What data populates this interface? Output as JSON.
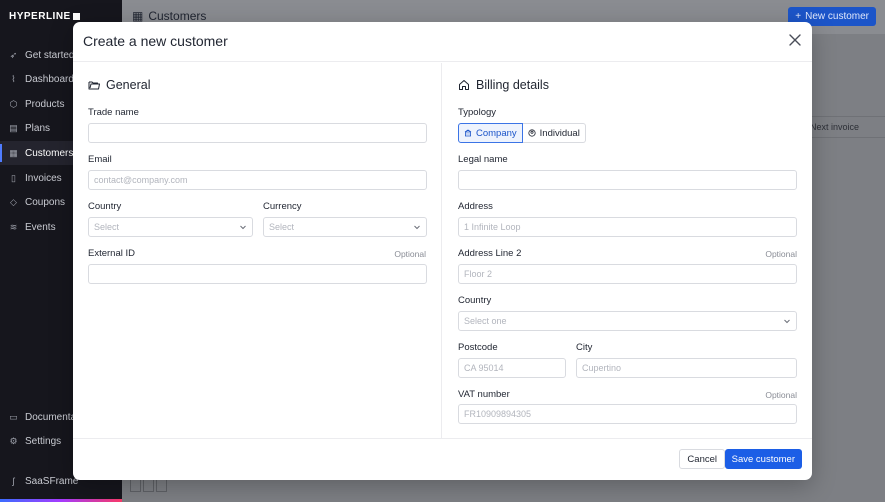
{
  "app": {
    "logo": "HYPERLINE",
    "page_title": "Customers",
    "new_customer_label": "New customer",
    "bg_column_label": "Next invoice"
  },
  "sidebar": {
    "items": [
      {
        "label": "Get started",
        "icon": "rocket-icon"
      },
      {
        "label": "Dashboard",
        "icon": "chart-icon"
      },
      {
        "label": "Products",
        "icon": "box-icon"
      },
      {
        "label": "Plans",
        "icon": "list-icon"
      },
      {
        "label": "Customers",
        "icon": "users-icon",
        "active": true
      },
      {
        "label": "Invoices",
        "icon": "file-icon"
      },
      {
        "label": "Coupons",
        "icon": "tag-icon"
      },
      {
        "label": "Events",
        "icon": "layers-icon"
      }
    ],
    "bottom_items": [
      {
        "label": "Documentation",
        "icon": "book-icon"
      },
      {
        "label": "Settings",
        "icon": "gear-icon"
      }
    ],
    "company": "SaaSFrame"
  },
  "modal": {
    "title": "Create a new customer",
    "general": {
      "title": "General",
      "trade_name_label": "Trade name",
      "trade_name_value": "",
      "email_label": "Email",
      "email_placeholder": "contact@company.com",
      "country_label": "Country",
      "country_placeholder": "Select",
      "currency_label": "Currency",
      "currency_placeholder": "Select",
      "external_id_label": "External ID",
      "external_id_optional": "Optional",
      "external_id_value": ""
    },
    "billing": {
      "title": "Billing details",
      "typology_label": "Typology",
      "typology_options": [
        "Company",
        "Individual"
      ],
      "typology_selected": "Company",
      "legal_name_label": "Legal name",
      "legal_name_value": "",
      "address_label": "Address",
      "address_placeholder": "1 Infinite Loop",
      "address2_label": "Address Line 2",
      "address2_optional": "Optional",
      "address2_placeholder": "Floor 2",
      "country_label": "Country",
      "country_placeholder": "Select one",
      "postcode_label": "Postcode",
      "postcode_placeholder": "CA 95014",
      "city_label": "City",
      "city_placeholder": "Cupertino",
      "vat_label": "VAT number",
      "vat_optional": "Optional",
      "vat_placeholder": "FR10909894305"
    },
    "footer": {
      "cancel_label": "Cancel",
      "save_label": "Save customer"
    }
  },
  "colors": {
    "primary": "#1c5ee6",
    "sidebar_bg": "#16161d",
    "selected_toggle_bg": "#eef3fd"
  }
}
